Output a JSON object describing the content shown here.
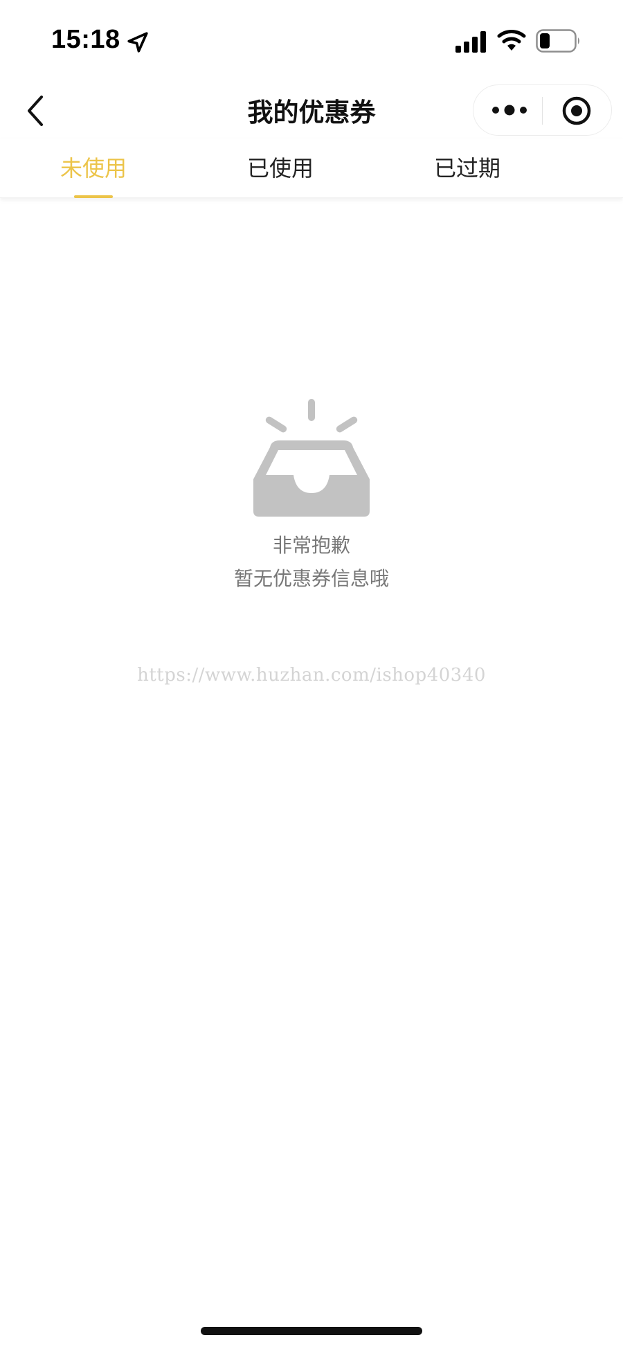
{
  "status_bar": {
    "time": "15:18",
    "icons": [
      "location-arrow-icon",
      "cellular-signal-icon",
      "wifi-icon",
      "battery-icon"
    ]
  },
  "nav": {
    "title": "我的优惠券",
    "back_icon": "chevron-left-icon",
    "capsule_icons": [
      "more-dots-icon",
      "close-target-icon"
    ]
  },
  "tabs": [
    {
      "label": "未使用",
      "active": true
    },
    {
      "label": "已使用",
      "active": false
    },
    {
      "label": "已过期",
      "active": false
    }
  ],
  "empty_state": {
    "icon": "empty-inbox-icon",
    "line1": "非常抱歉",
    "line2": "暂无优惠券信息哦"
  },
  "watermark": "https://www.huzhan.com/ishop40340",
  "colors": {
    "accent": "#ecc449",
    "text_primary": "#111111",
    "text_secondary": "#777777",
    "icon_gray": "#c2c2c2"
  }
}
